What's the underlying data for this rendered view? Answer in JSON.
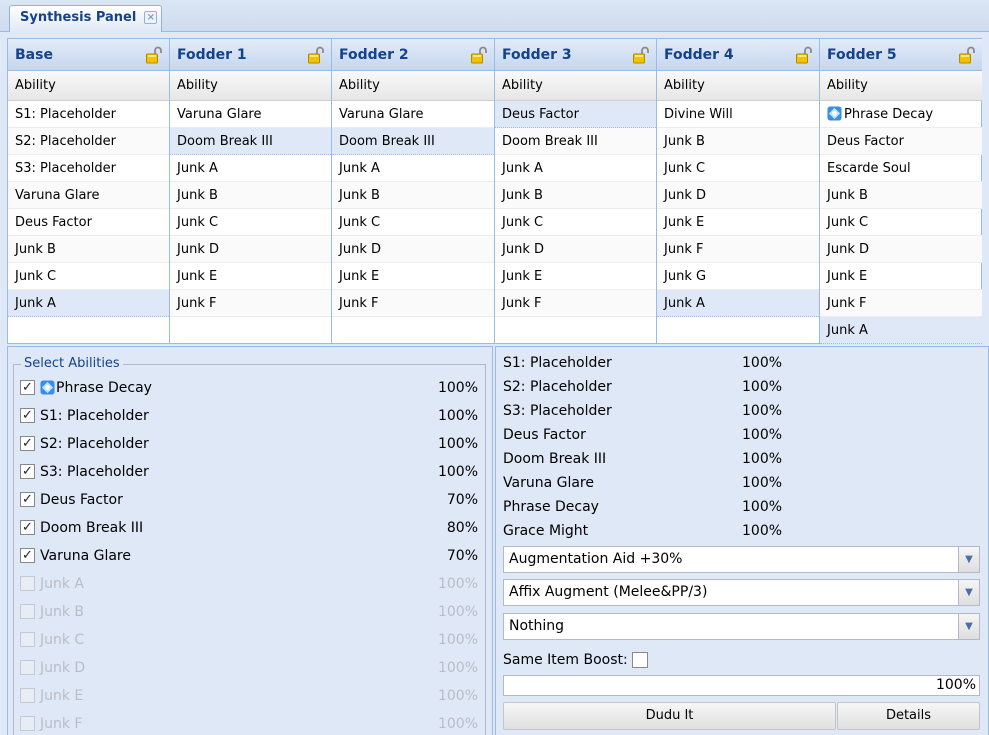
{
  "tab": {
    "title": "Synthesis Panel",
    "close_glyph": "×"
  },
  "columns": [
    {
      "header": "Base",
      "subheader": "Ability",
      "rows": [
        "S1: Placeholder",
        "S2: Placeholder",
        "S3: Placeholder",
        "Varuna Glare",
        "Deus Factor",
        "Junk B",
        "Junk C",
        "Junk A"
      ],
      "selected": 7
    },
    {
      "header": "Fodder 1",
      "subheader": "Ability",
      "rows": [
        "Varuna Glare",
        "Doom Break III",
        "Junk A",
        "Junk B",
        "Junk C",
        "Junk D",
        "Junk E",
        "Junk F"
      ],
      "selected": 1
    },
    {
      "header": "Fodder 2",
      "subheader": "Ability",
      "rows": [
        "Varuna Glare",
        "Doom Break III",
        "Junk A",
        "Junk B",
        "Junk C",
        "Junk D",
        "Junk E",
        "Junk F"
      ],
      "selected": 1
    },
    {
      "header": "Fodder 3",
      "subheader": "Ability",
      "rows": [
        "Deus Factor",
        "Doom Break III",
        "Junk A",
        "Junk B",
        "Junk C",
        "Junk D",
        "Junk E",
        "Junk F"
      ],
      "selected": 0
    },
    {
      "header": "Fodder 4",
      "subheader": "Ability",
      "rows": [
        "Divine Will",
        "Junk B",
        "Junk C",
        "Junk D",
        "Junk E",
        "Junk F",
        "Junk G",
        "Junk A"
      ],
      "selected": 7
    },
    {
      "header": "Fodder 5",
      "subheader": "Ability",
      "rows": [
        "Phrase Decay",
        "Deus Factor",
        "Escarde Soul",
        "Junk B",
        "Junk C",
        "Junk D",
        "Junk E",
        "Junk F",
        "Junk A"
      ],
      "selected": 8,
      "gem_row": 0
    }
  ],
  "select_abilities": {
    "legend": "Select Abilities",
    "items": [
      {
        "label": "Phrase Decay",
        "pct": "100%",
        "checked": true,
        "enabled": true,
        "gem": true
      },
      {
        "label": "S1: Placeholder",
        "pct": "100%",
        "checked": true,
        "enabled": true
      },
      {
        "label": "S2: Placeholder",
        "pct": "100%",
        "checked": true,
        "enabled": true
      },
      {
        "label": "S3: Placeholder",
        "pct": "100%",
        "checked": true,
        "enabled": true
      },
      {
        "label": "Deus Factor",
        "pct": "70%",
        "checked": true,
        "enabled": true
      },
      {
        "label": "Doom Break III",
        "pct": "80%",
        "checked": true,
        "enabled": true
      },
      {
        "label": "Varuna Glare",
        "pct": "70%",
        "checked": true,
        "enabled": true
      },
      {
        "label": "Junk A",
        "pct": "100%",
        "checked": false,
        "enabled": false
      },
      {
        "label": "Junk B",
        "pct": "100%",
        "checked": false,
        "enabled": false
      },
      {
        "label": "Junk C",
        "pct": "100%",
        "checked": false,
        "enabled": false
      },
      {
        "label": "Junk D",
        "pct": "100%",
        "checked": false,
        "enabled": false
      },
      {
        "label": "Junk E",
        "pct": "100%",
        "checked": false,
        "enabled": false
      },
      {
        "label": "Junk F",
        "pct": "100%",
        "checked": false,
        "enabled": false
      }
    ],
    "check_glyph": "✓"
  },
  "results": [
    {
      "label": "S1: Placeholder",
      "pct": "100%"
    },
    {
      "label": "S2: Placeholder",
      "pct": "100%"
    },
    {
      "label": "S3: Placeholder",
      "pct": "100%"
    },
    {
      "label": "Deus Factor",
      "pct": "100%"
    },
    {
      "label": "Doom Break III",
      "pct": "100%"
    },
    {
      "label": "Varuna Glare",
      "pct": "100%"
    },
    {
      "label": "Phrase Decay",
      "pct": "100%"
    },
    {
      "label": "Grace Might",
      "pct": "100%"
    }
  ],
  "combos": [
    "Augmentation Aid +30%",
    "Affix Augment (Melee&PP/3)",
    "Nothing"
  ],
  "combo_trigger_glyph": "▼",
  "same_item_boost": {
    "label": "Same Item Boost:",
    "checked": false
  },
  "progress": {
    "text": "100%",
    "value": 1.0
  },
  "buttons": {
    "dudu": "Dudu It",
    "details": "Details"
  },
  "colors": {
    "accent": "#15428b",
    "border": "#99bbe8",
    "panel": "#dfe8f6",
    "gem": "#3a8ee6"
  }
}
